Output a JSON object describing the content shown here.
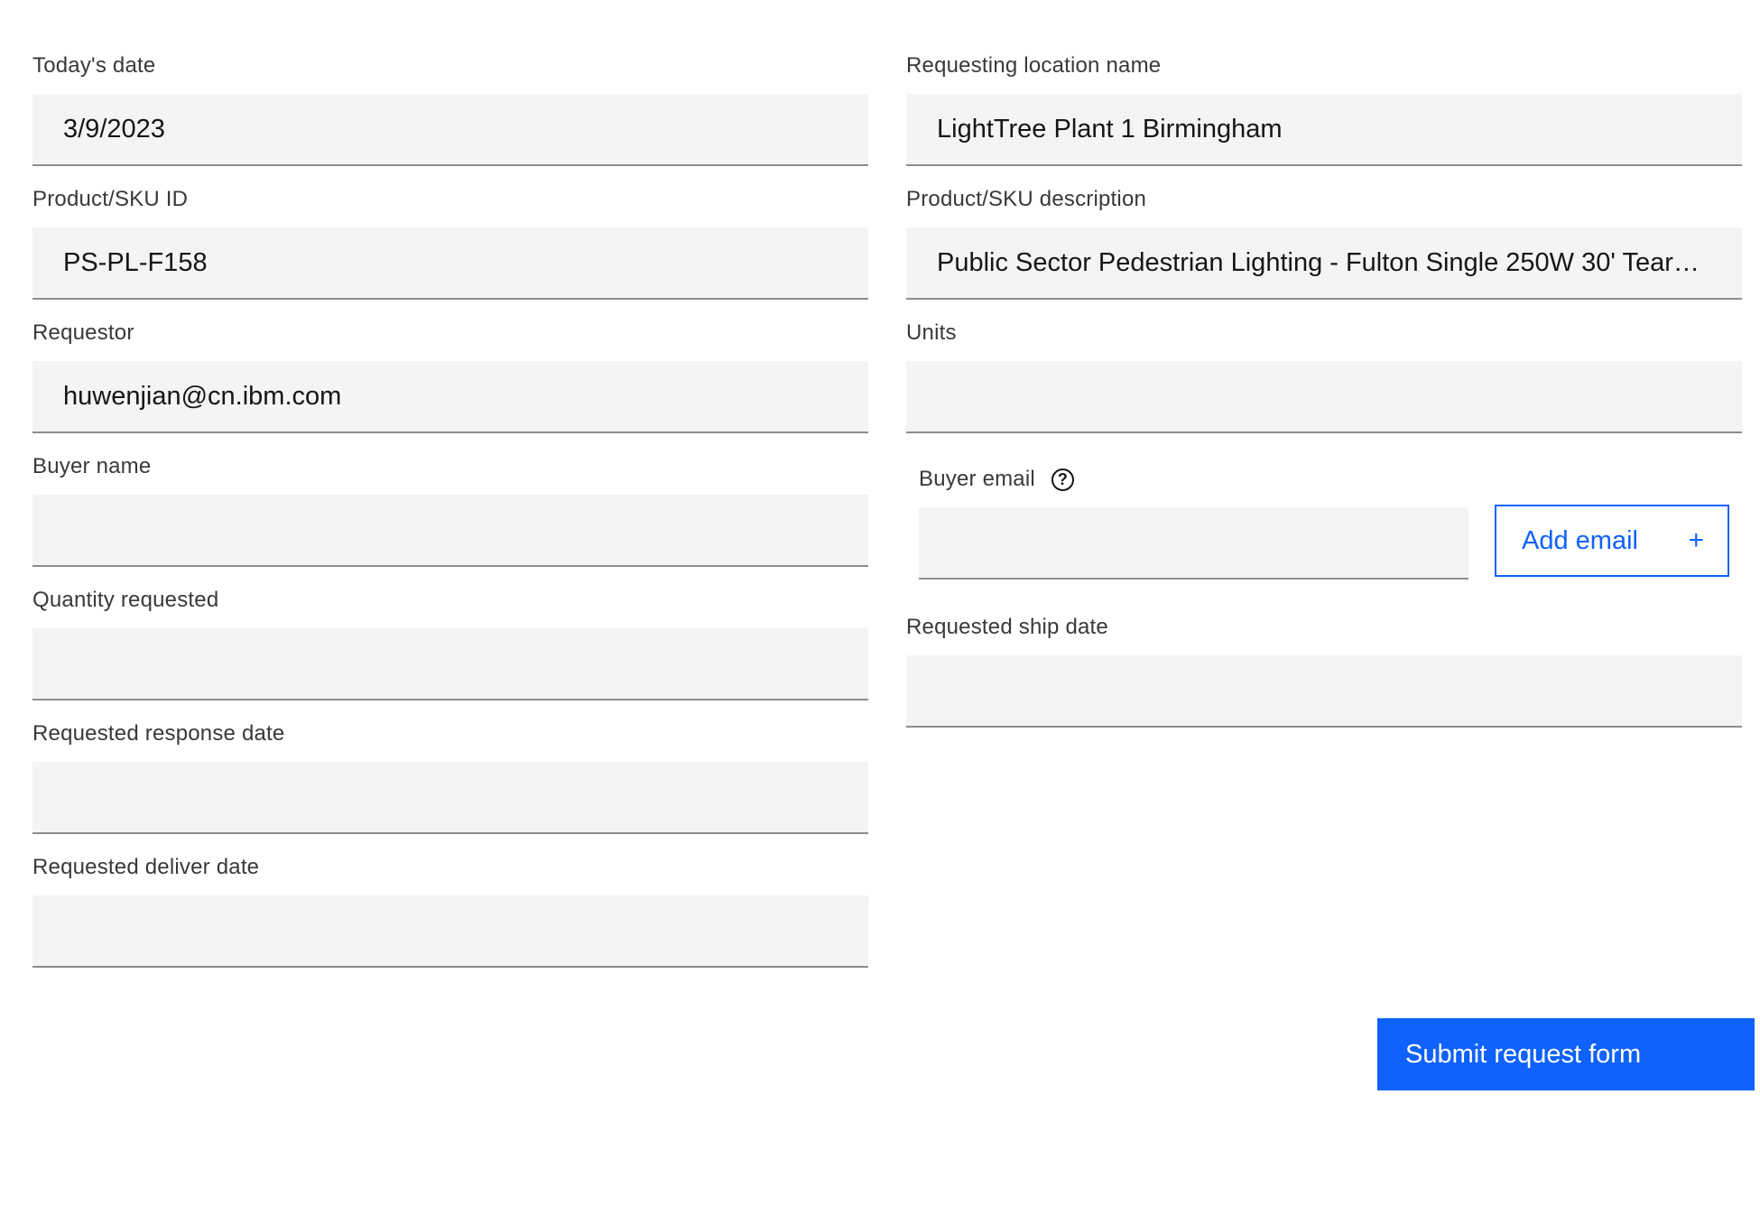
{
  "form": {
    "left": [
      {
        "label": "Today's date",
        "value": "3/9/2023"
      },
      {
        "label": "Product/SKU ID",
        "value": "PS-PL-F158"
      },
      {
        "label": "Requestor",
        "value": "huwenjian@cn.ibm.com"
      },
      {
        "label": "Buyer name",
        "value": ""
      },
      {
        "label": "Quantity requested",
        "value": ""
      },
      {
        "label": "Requested response date",
        "value": ""
      },
      {
        "label": "Requested deliver date",
        "value": ""
      }
    ],
    "right": [
      {
        "label": "Requesting location name",
        "value": "LightTree Plant 1 Birmingham"
      },
      {
        "label": "Product/SKU description",
        "value": "Public Sector Pedestrian Lighting - Fulton Single 250W 30' Teardr..."
      },
      {
        "label": "Units",
        "value": ""
      }
    ],
    "buyer_email": {
      "label": "Buyer email",
      "help_icon": "help-circle-icon",
      "value": "",
      "add_button_label": "Add email",
      "add_icon": "+"
    },
    "ship_date": {
      "label": "Requested ship date",
      "value": ""
    },
    "submit_label": "Submit request form"
  },
  "colors": {
    "accent": "#0f62fe",
    "field_bg": "#f4f4f4",
    "field_border": "#8d8d8d",
    "label": "#393939",
    "text": "#161616"
  }
}
